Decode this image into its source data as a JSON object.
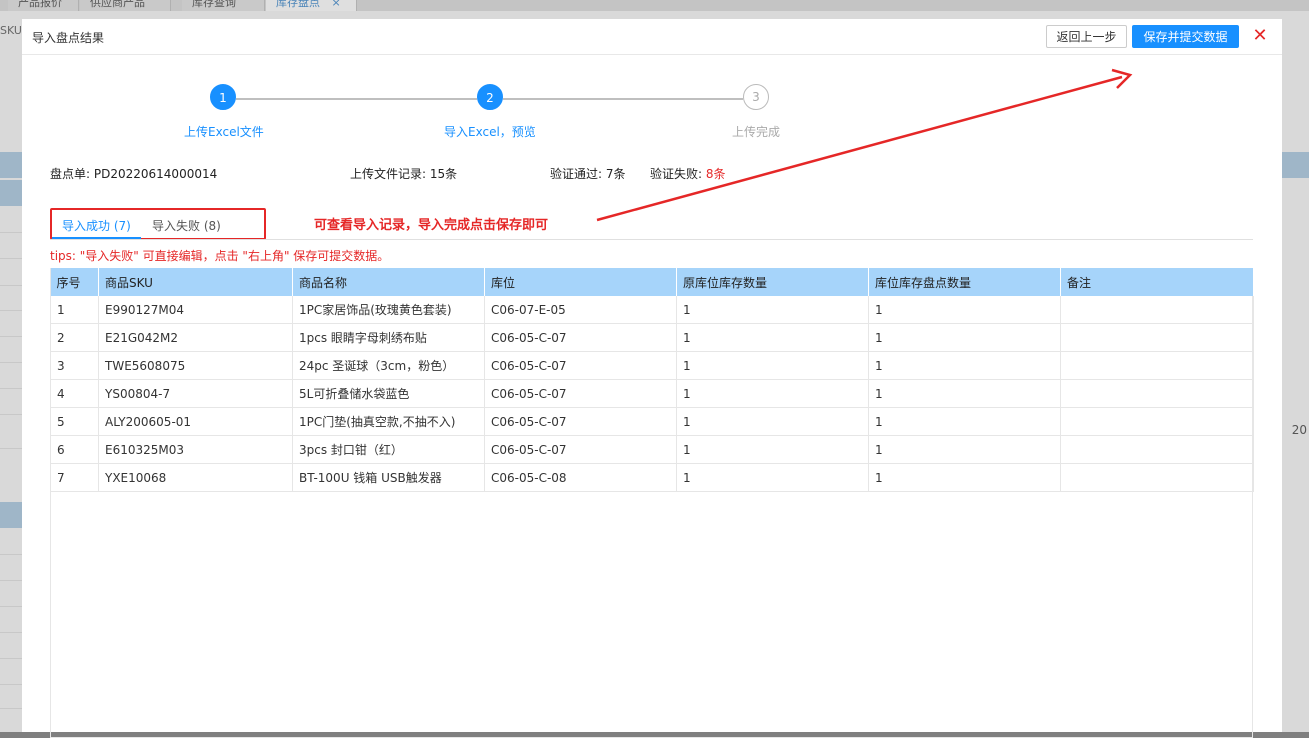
{
  "background": {
    "tabs": [
      "产品报价",
      "供应商产品",
      "库存查询",
      "库存盘点"
    ],
    "tab_close": "×",
    "left_text": "SKU",
    "right_text": "20"
  },
  "modal": {
    "title": "导入盘点结果",
    "back_label": "返回上一步",
    "save_label": "保存并提交数据",
    "close_icon": "✕"
  },
  "steps": [
    {
      "num": "1",
      "label": "上传Excel文件",
      "state": "done"
    },
    {
      "num": "2",
      "label": "导入Excel，预览",
      "state": "done"
    },
    {
      "num": "3",
      "label": "上传完成",
      "state": "todo"
    }
  ],
  "summary": {
    "order_label": "盘点单:",
    "order_value": "PD20220614000014",
    "records_label": "上传文件记录:",
    "records_value": "15条",
    "pass_label": "验证通过:",
    "pass_value": "7条",
    "fail_label": "验证失败:",
    "fail_value": "8条"
  },
  "tabs": {
    "success": "导入成功 (7)",
    "failed": "导入失败 (8)"
  },
  "annotation": "可查看导入记录，导入完成点击保存即可",
  "tips": "tips: \"导入失败\" 可直接编辑，点击 \"右上角\" 保存可提交数据。",
  "table": {
    "headers": [
      "序号",
      "商品SKU",
      "商品名称",
      "库位",
      "原库位库存数量",
      "库位库存盘点数量",
      "备注"
    ],
    "rows": [
      [
        "1",
        "E990127M04",
        "1PC家居饰品(玫瑰黄色套装)",
        "C06-07-E-05",
        "1",
        "1",
        ""
      ],
      [
        "2",
        "E21G042M2",
        "1pcs 眼睛字母刺绣布贴",
        "C06-05-C-07",
        "1",
        "1",
        ""
      ],
      [
        "3",
        "TWE5608075",
        "24pc 圣诞球（3cm，粉色）",
        "C06-05-C-07",
        "1",
        "1",
        ""
      ],
      [
        "4",
        "YS00804-7",
        "5L可折叠储水袋蓝色",
        "C06-05-C-07",
        "1",
        "1",
        ""
      ],
      [
        "5",
        "ALY200605-01",
        "1PC门垫(抽真空款,不抽不入)",
        "C06-05-C-07",
        "1",
        "1",
        ""
      ],
      [
        "6",
        "E610325M03",
        "3pcs 封口钳（红）",
        "C06-05-C-07",
        "1",
        "1",
        ""
      ],
      [
        "7",
        "YXE10068",
        "BT-100U 钱箱 USB触发器",
        "C06-05-C-08",
        "1",
        "1",
        ""
      ]
    ]
  },
  "colors": {
    "primary": "#1890ff",
    "alert": "#e52727",
    "header_bg": "#a6d4fa"
  }
}
